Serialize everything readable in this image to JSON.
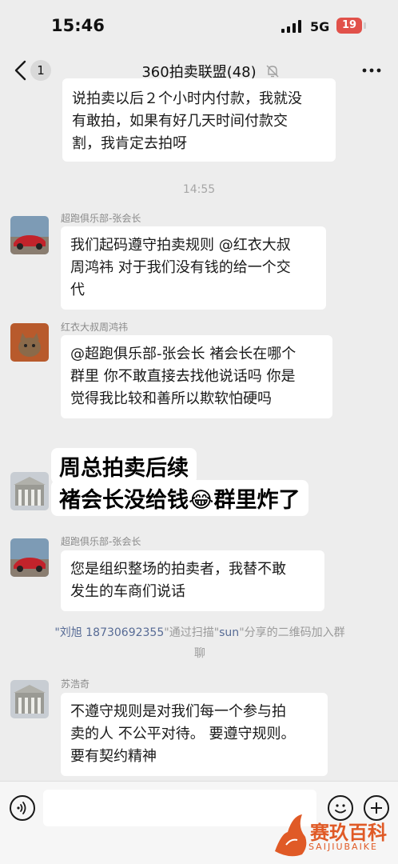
{
  "status": {
    "time": "15:46",
    "network": "5G",
    "battery": "19"
  },
  "nav": {
    "unread_count": "1",
    "title": "360拍卖联盟(48)"
  },
  "messages": [
    {
      "lines": [
        "说拍卖以后２个小时内付款，我就没",
        "有敢拍，如果有好几天时间付款交",
        "割，我肯定去拍呀"
      ]
    },
    {
      "lines": [
        "我们起码遵守拍卖规则 @红衣大叔",
        "周鸿祎 对于我们没有钱的给一个交",
        "代"
      ],
      "sender": "超跑俱乐部-张会长"
    },
    {
      "lines": [
        "@超跑俱乐部-张会长 褚会长在哪个",
        "群里 你不敢直接去找他说话吗 你是",
        "觉得我比较和善所以欺软怕硬吗"
      ],
      "sender": "红衣大叔周鸿祎"
    },
    {
      "lines": [
        "您是组织整场的拍卖者，我替不敢",
        "发生的车商们说话"
      ],
      "sender": "超跑俱乐部-张会长"
    },
    {
      "lines": [
        "不遵守规则是对我们每一个参与拍",
        "卖的人 不公平对待。 要遵守规则。",
        "要有契约精神"
      ],
      "sender": "苏浩奇"
    }
  ],
  "time_divider": "14:55",
  "overlay": {
    "line1": "周总拍卖后续",
    "line2": "褚会长没给钱😂群里炸了"
  },
  "system": {
    "name": "\"刘旭",
    "phone": "18730692355",
    "mid": "\"通过扫描\"",
    "sun": "sun",
    "tail": "\"分享的二维码加入群",
    "line2": "聊"
  },
  "watermark": {
    "text": "赛玖百科",
    "sub": "SAIJIUBAIKE"
  },
  "colors": {
    "background": "#ededed",
    "bubble": "#ffffff",
    "link": "#576b95",
    "battery": "#e1514a",
    "watermark": "#e05a26"
  }
}
